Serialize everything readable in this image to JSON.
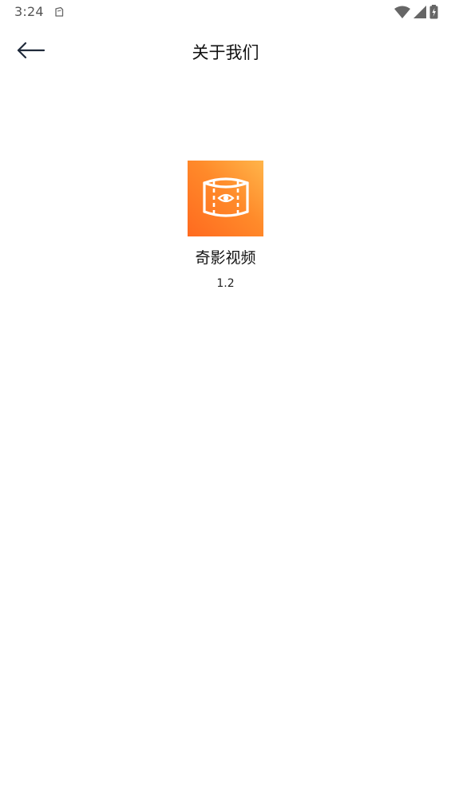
{
  "status_bar": {
    "time": "3:24",
    "icons": [
      "notification-icon",
      "wifi-icon",
      "signal-icon",
      "battery-icon"
    ]
  },
  "app_bar": {
    "title": "关于我们",
    "back_icon": "back-arrow-icon"
  },
  "about": {
    "app_icon": "video-360-eye-icon",
    "app_name": "奇影视频",
    "version": "1.2"
  },
  "colors": {
    "icon_gradient_start": "#ff6a1f",
    "icon_gradient_end": "#ffb54a",
    "title_text": "#111111",
    "status_text": "#555555"
  }
}
